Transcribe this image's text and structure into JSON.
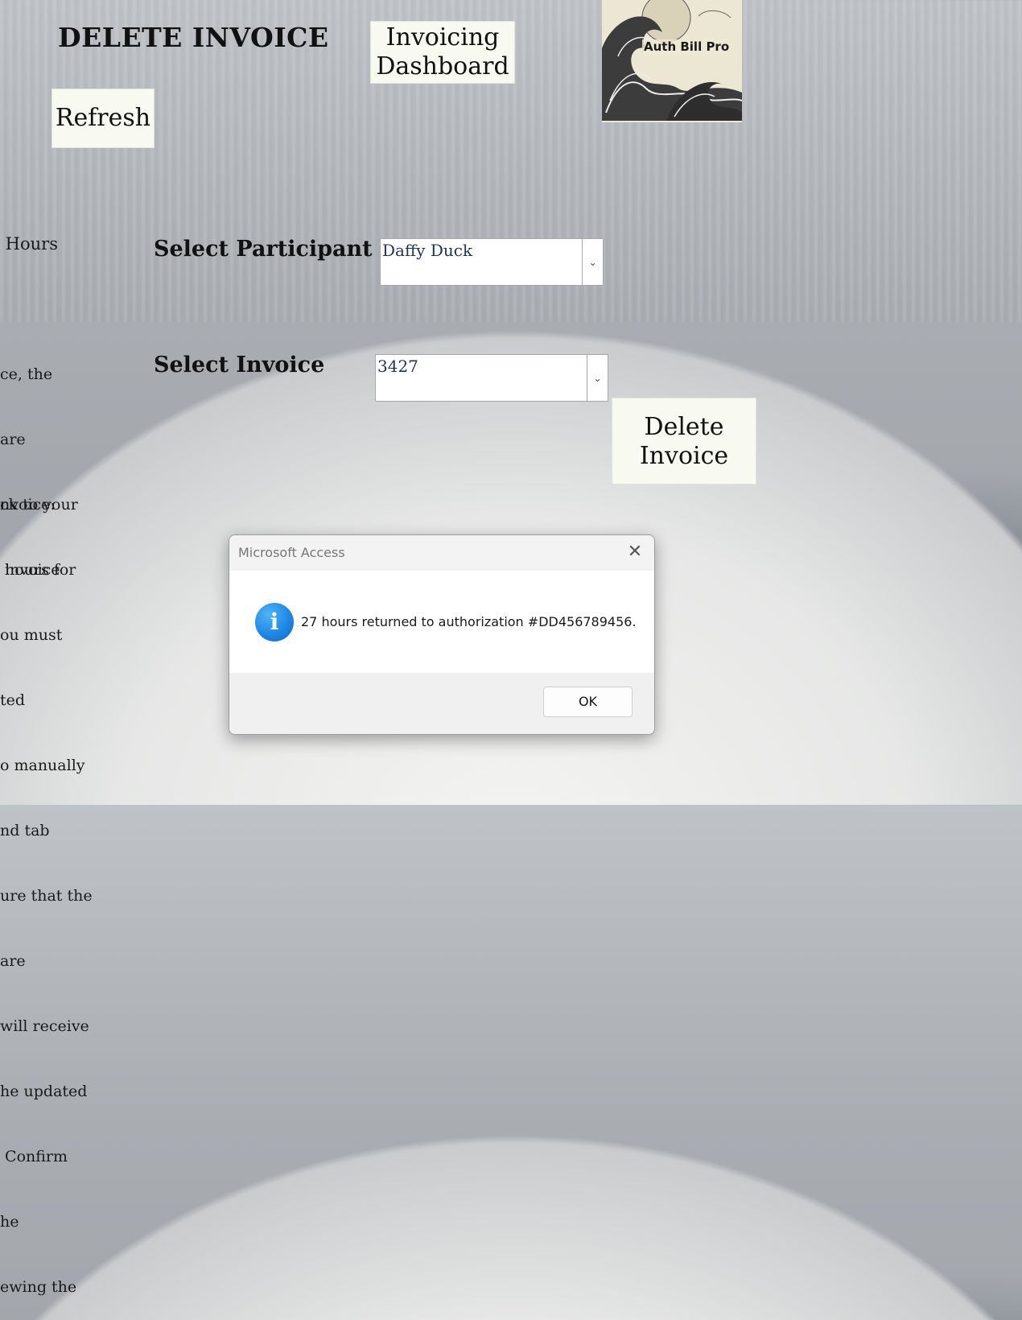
{
  "header": {
    "title": "DELETE INVOICE",
    "dashboard_button": [
      "Invoicing",
      "Dashboard"
    ],
    "refresh_button": "Refresh",
    "logo_text": "Auth Bill Pro"
  },
  "side_panel": {
    "heading_fragment": " Hours",
    "block1": [
      "ce, the",
      "are",
      "ck to your",
      " hours for"
    ],
    "block2": [
      "nvoice:",
      " invoice",
      "ou must",
      "ted",
      "o manually",
      "nd tab",
      "ure that the",
      "are",
      "will receive",
      "he updated",
      " Confirm",
      "he",
      "ewing the"
    ]
  },
  "form": {
    "participant_label": "Select Participant",
    "participant_value": "Daffy Duck",
    "invoice_label": "Select Invoice",
    "invoice_value": "3427",
    "delete_button": [
      "Delete",
      "Invoice"
    ]
  },
  "dialog": {
    "title": "Microsoft Access",
    "message": "27 hours returned to authorization #DD456789456.",
    "ok_label": "OK",
    "icon": "info-icon"
  }
}
